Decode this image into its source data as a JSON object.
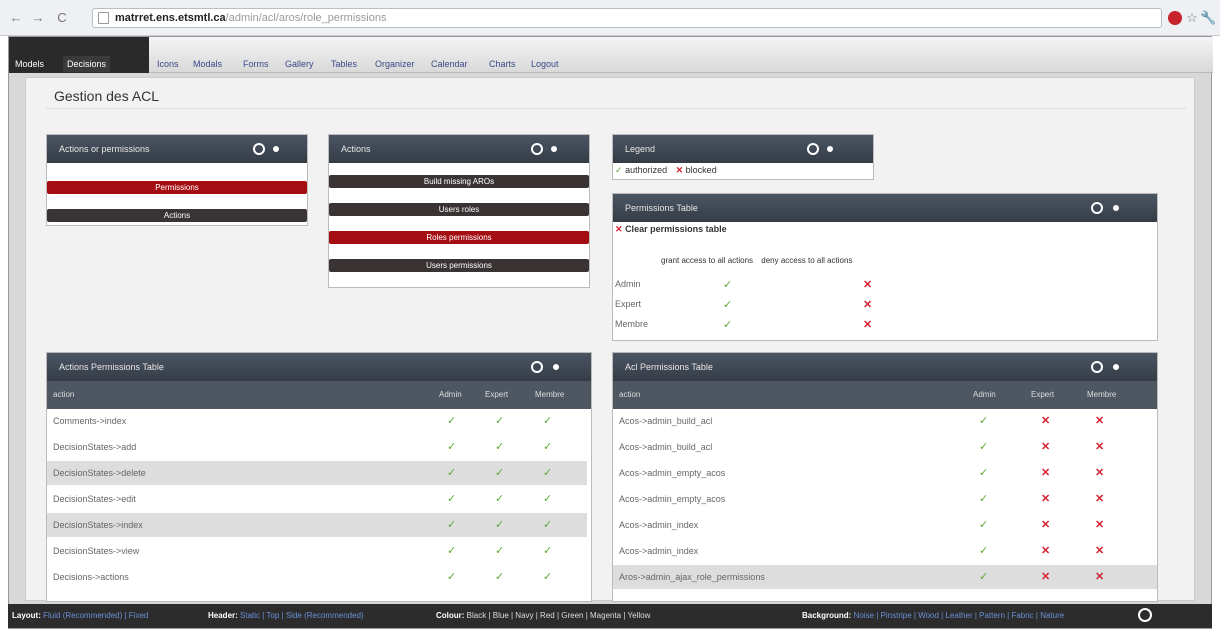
{
  "browser": {
    "url_host": "matrret.ens.etsmtl.ca",
    "url_path": "/admin/acl/aros/role_permissions"
  },
  "menu": {
    "items": [
      "Models",
      "Decisions",
      "Icons",
      "Modals",
      "Forms",
      "Gallery",
      "Tables",
      "Organizer",
      "Calendar",
      "Charts",
      "Logout"
    ]
  },
  "page": {
    "title": "Gestion des ACL"
  },
  "actions_or_permissions": {
    "title": "Actions or permissions",
    "buttons": [
      "Permissions",
      "Actions"
    ]
  },
  "actions": {
    "title": "Actions",
    "buttons": [
      "Build missing AROs",
      "Users roles",
      "Roles permissions",
      "Users permissions"
    ]
  },
  "legend": {
    "title": "Legend",
    "authorized": "authorized",
    "blocked": "blocked"
  },
  "permissions_table": {
    "title": "Permissions Table",
    "clear_label": "Clear permissions table",
    "col_grant": "grant access to all actions",
    "col_deny": "deny access to all actions",
    "roles": [
      "Admin",
      "Expert",
      "Membre"
    ]
  },
  "actions_permissions": {
    "title": "Actions Permissions Table",
    "headers": [
      "action",
      "Admin",
      "Expert",
      "Membre"
    ],
    "rows": [
      "Comments->index",
      "DecisionStates->add",
      "DecisionStates->delete",
      "DecisionStates->edit",
      "DecisionStates->index",
      "DecisionStates->view",
      "Decisions->actions"
    ]
  },
  "acl_permissions": {
    "title": "Acl Permissions Table",
    "headers": [
      "action",
      "Admin",
      "Expert",
      "Membre"
    ],
    "rows": [
      "Acos->admin_build_acl",
      "Acos->admin_build_acl",
      "Acos->admin_empty_acos",
      "Acos->admin_empty_acos",
      "Acos->admin_index",
      "Acos->admin_index",
      "Aros->admin_ajax_role_permissions"
    ]
  },
  "bottombar": {
    "layout_label": "Layout:",
    "layout_values": "Fluid (Recommended) | Fixed",
    "header_label": "Header:",
    "header_values": "Static | Top | Side (Recommended)",
    "colour_label": "Colour:",
    "colour_values": "Black | Blue | Navy | Red | Green | Magenta | Yellow",
    "background_label": "Background:",
    "background_values": "Noise | Pinstripe | Wood | Leather | Pattern | Fabric | Nature"
  }
}
